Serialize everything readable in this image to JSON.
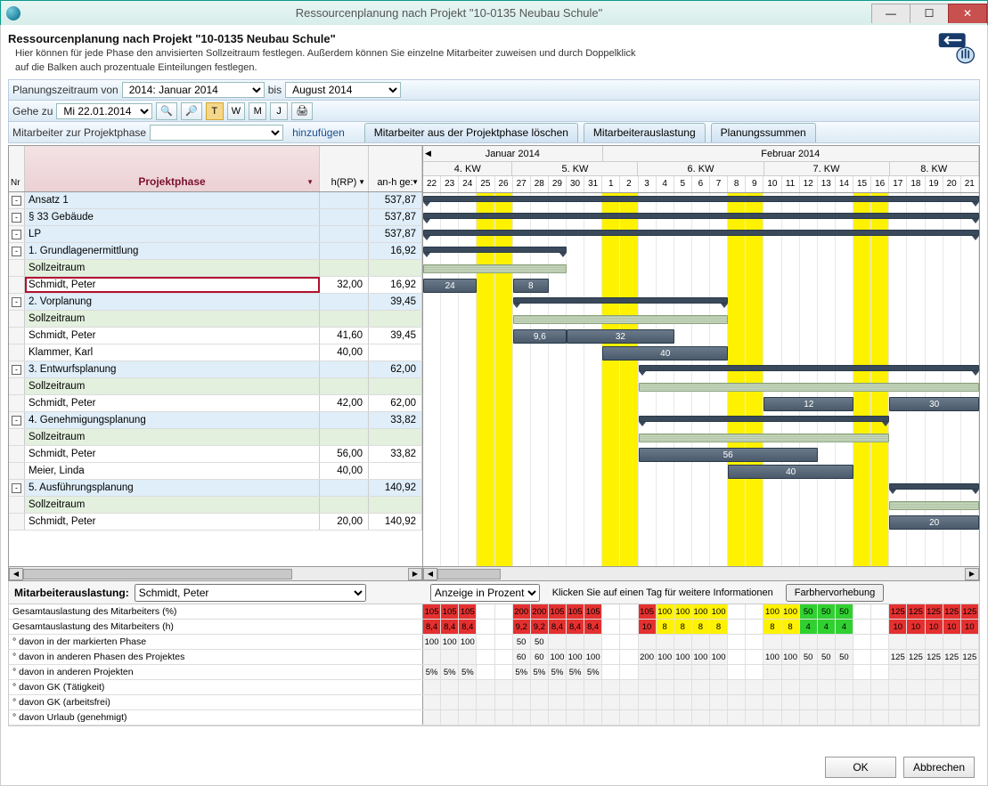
{
  "window": {
    "title": "Ressourcenplanung nach Projekt \"10-0135 Neubau Schule\"",
    "min": "—",
    "max": "☐",
    "close": "✕"
  },
  "header": {
    "title": "Ressourcenplanung nach Projekt \"10-0135 Neubau Schule\"",
    "desc1": "Hier können für jede Phase den anvisierten Sollzeitraum festlegen. Außerdem können Sie einzelne Mitarbeiter zuweisen und durch Doppelklick",
    "desc2": "auf die Balken auch prozentuale Einteilungen festlegen."
  },
  "toolbar1": {
    "label1": "Planungszeitraum von",
    "from": "2014: Januar 2014",
    "to_lbl": "bis",
    "to": "August 2014"
  },
  "toolbar2": {
    "goto_lbl": "Gehe zu",
    "goto_date": "Mi 22.01.2014",
    "btns": [
      "T",
      "W",
      "M",
      "J"
    ]
  },
  "toolbar3": {
    "assign_lbl": "Mitarbeiter zur Projektphase",
    "add": "hinzufügen",
    "tabs": [
      "Mitarbeiter aus der Projektphase löschen",
      "Mitarbeiterauslastung",
      "Planungssummen"
    ]
  },
  "columns": {
    "nr": "Nr",
    "phase": "Projektphase",
    "hrp": "h(RP)",
    "anh": "an-h ge:"
  },
  "months": [
    "Januar 2014",
    "Februar 2014"
  ],
  "weeks": [
    "4. KW",
    "5. KW",
    "6. KW",
    "7. KW",
    "8. KW"
  ],
  "days": [
    "22",
    "23",
    "24",
    "25",
    "26",
    "27",
    "28",
    "29",
    "30",
    "31",
    "1",
    "2",
    "3",
    "4",
    "5",
    "6",
    "7",
    "8",
    "9",
    "10",
    "11",
    "12",
    "13",
    "14",
    "15",
    "16",
    "17",
    "18",
    "19",
    "20",
    "21"
  ],
  "weekend_idx": [
    3,
    4,
    10,
    11,
    17,
    18,
    24,
    25
  ],
  "rows": [
    {
      "exp": "-",
      "label": "Ansatz 1",
      "hrp": "",
      "anh": "537,87",
      "cls": "row-blue",
      "type": "sum",
      "bar": {
        "start": 0,
        "end": 31
      }
    },
    {
      "exp": "-",
      "label": "§ 33 Gebäude",
      "hrp": "",
      "anh": "537,87",
      "cls": "row-blue",
      "type": "sum",
      "bar": {
        "start": 0,
        "end": 31
      }
    },
    {
      "exp": "-",
      "label": "LP",
      "hrp": "",
      "anh": "537,87",
      "cls": "row-blue",
      "type": "sum",
      "bar": {
        "start": 0,
        "end": 31
      }
    },
    {
      "exp": "-",
      "label": "1. Grundlagenermittlung",
      "hrp": "",
      "anh": "16,92",
      "cls": "row-blue",
      "type": "sum",
      "bar": {
        "start": 0,
        "end": 8
      }
    },
    {
      "exp": "",
      "label": "Sollzeitraum",
      "hrp": "",
      "anh": "",
      "cls": "row-green",
      "type": "soll",
      "bar": {
        "start": 0,
        "end": 8
      }
    },
    {
      "exp": "",
      "label": "Schmidt, Peter",
      "hrp": "32,00",
      "anh": "16,92",
      "cls": "row-white row-selected",
      "type": "work",
      "bars": [
        {
          "start": 0,
          "end": 3,
          "txt": "24"
        },
        {
          "start": 5,
          "end": 7,
          "txt": "8"
        }
      ]
    },
    {
      "exp": "-",
      "label": "2. Vorplanung",
      "hrp": "",
      "anh": "39,45",
      "cls": "row-blue",
      "type": "sum",
      "bar": {
        "start": 5,
        "end": 17
      }
    },
    {
      "exp": "",
      "label": "Sollzeitraum",
      "hrp": "",
      "anh": "",
      "cls": "row-green",
      "type": "soll",
      "bar": {
        "start": 5,
        "end": 17
      }
    },
    {
      "exp": "",
      "label": "Schmidt, Peter",
      "hrp": "41,60",
      "anh": "39,45",
      "cls": "row-white",
      "type": "work",
      "bars": [
        {
          "start": 5,
          "end": 8,
          "txt": "9,6"
        },
        {
          "start": 8,
          "end": 14,
          "txt": "32"
        }
      ]
    },
    {
      "exp": "",
      "label": "Klammer, Karl",
      "hrp": "40,00",
      "anh": "",
      "cls": "row-white",
      "type": "work",
      "bars": [
        {
          "start": 10,
          "end": 17,
          "txt": "40"
        }
      ]
    },
    {
      "exp": "-",
      "label": "3. Entwurfsplanung",
      "hrp": "",
      "anh": "62,00",
      "cls": "row-blue",
      "type": "sum",
      "bar": {
        "start": 12,
        "end": 31
      }
    },
    {
      "exp": "",
      "label": "Sollzeitraum",
      "hrp": "",
      "anh": "",
      "cls": "row-green",
      "type": "soll",
      "bar": {
        "start": 12,
        "end": 31
      }
    },
    {
      "exp": "",
      "label": "Schmidt, Peter",
      "hrp": "42,00",
      "anh": "62,00",
      "cls": "row-white",
      "type": "work",
      "bars": [
        {
          "start": 19,
          "end": 24,
          "txt": "12"
        },
        {
          "start": 26,
          "end": 31,
          "txt": "30"
        }
      ]
    },
    {
      "exp": "-",
      "label": "4. Genehmigungsplanung",
      "hrp": "",
      "anh": "33,82",
      "cls": "row-blue",
      "type": "sum",
      "bar": {
        "start": 12,
        "end": 26
      }
    },
    {
      "exp": "",
      "label": "Sollzeitraum",
      "hrp": "",
      "anh": "",
      "cls": "row-green",
      "type": "soll",
      "bar": {
        "start": 12,
        "end": 26
      }
    },
    {
      "exp": "",
      "label": "Schmidt, Peter",
      "hrp": "56,00",
      "anh": "33,82",
      "cls": "row-white",
      "type": "work",
      "bars": [
        {
          "start": 12,
          "end": 22,
          "txt": "56"
        }
      ]
    },
    {
      "exp": "",
      "label": "Meier, Linda",
      "hrp": "40,00",
      "anh": "",
      "cls": "row-white",
      "type": "work",
      "bars": [
        {
          "start": 17,
          "end": 24,
          "txt": "40"
        }
      ]
    },
    {
      "exp": "-",
      "label": "5. Ausführungsplanung",
      "hrp": "",
      "anh": "140,92",
      "cls": "row-blue",
      "type": "sum",
      "bar": {
        "start": 26,
        "end": 31
      }
    },
    {
      "exp": "",
      "label": "Sollzeitraum",
      "hrp": "",
      "anh": "",
      "cls": "row-green",
      "type": "soll",
      "bar": {
        "start": 26,
        "end": 31
      }
    },
    {
      "exp": "",
      "label": "Schmidt, Peter",
      "hrp": "20,00",
      "anh": "140,92",
      "cls": "row-white",
      "type": "work",
      "bars": [
        {
          "start": 26,
          "end": 31,
          "txt": "20"
        }
      ]
    }
  ],
  "util": {
    "label": "Mitarbeiterauslastung:",
    "employee": "Schmidt, Peter",
    "mode": "Anzeige in Prozent",
    "hint": "Klicken Sie auf einen Tag für weitere Informationen",
    "color_btn": "Farbhervorhebung",
    "rows": [
      {
        "label": "Gesamtauslastung des Mitarbeiters (%)",
        "cells": [
          {
            "v": "105",
            "c": "red"
          },
          {
            "v": "105",
            "c": "red"
          },
          {
            "v": "105",
            "c": "red"
          },
          {
            "v": "",
            "c": "blank"
          },
          {
            "v": "",
            "c": "blank"
          },
          {
            "v": "200",
            "c": "red"
          },
          {
            "v": "200",
            "c": "red"
          },
          {
            "v": "105",
            "c": "red"
          },
          {
            "v": "105",
            "c": "red"
          },
          {
            "v": "105",
            "c": "red"
          },
          {
            "v": "",
            "c": "blank"
          },
          {
            "v": "",
            "c": "blank"
          },
          {
            "v": "105",
            "c": "red"
          },
          {
            "v": "100",
            "c": "yellow"
          },
          {
            "v": "100",
            "c": "yellow"
          },
          {
            "v": "100",
            "c": "yellow"
          },
          {
            "v": "100",
            "c": "yellow"
          },
          {
            "v": "",
            "c": "blank"
          },
          {
            "v": "",
            "c": "blank"
          },
          {
            "v": "100",
            "c": "yellow"
          },
          {
            "v": "100",
            "c": "yellow"
          },
          {
            "v": "50",
            "c": "green"
          },
          {
            "v": "50",
            "c": "green"
          },
          {
            "v": "50",
            "c": "green"
          },
          {
            "v": "",
            "c": "blank"
          },
          {
            "v": "",
            "c": "blank"
          },
          {
            "v": "125",
            "c": "red"
          },
          {
            "v": "125",
            "c": "red"
          },
          {
            "v": "125",
            "c": "red"
          },
          {
            "v": "125",
            "c": "red"
          },
          {
            "v": "125",
            "c": "red"
          }
        ]
      },
      {
        "label": "Gesamtauslastung des Mitarbeiters (h)",
        "cells": [
          {
            "v": "8,4",
            "c": "red"
          },
          {
            "v": "8,4",
            "c": "red"
          },
          {
            "v": "8,4",
            "c": "red"
          },
          {
            "v": "",
            "c": "blank"
          },
          {
            "v": "",
            "c": "blank"
          },
          {
            "v": "9,2",
            "c": "red"
          },
          {
            "v": "9,2",
            "c": "red"
          },
          {
            "v": "8,4",
            "c": "red"
          },
          {
            "v": "8,4",
            "c": "red"
          },
          {
            "v": "8,4",
            "c": "red"
          },
          {
            "v": "",
            "c": "blank"
          },
          {
            "v": "",
            "c": "blank"
          },
          {
            "v": "10",
            "c": "red"
          },
          {
            "v": "8",
            "c": "yellow"
          },
          {
            "v": "8",
            "c": "yellow"
          },
          {
            "v": "8",
            "c": "yellow"
          },
          {
            "v": "8",
            "c": "yellow"
          },
          {
            "v": "",
            "c": "blank"
          },
          {
            "v": "",
            "c": "blank"
          },
          {
            "v": "8",
            "c": "yellow"
          },
          {
            "v": "8",
            "c": "yellow"
          },
          {
            "v": "4",
            "c": "green"
          },
          {
            "v": "4",
            "c": "green"
          },
          {
            "v": "4",
            "c": "green"
          },
          {
            "v": "",
            "c": "blank"
          },
          {
            "v": "",
            "c": "blank"
          },
          {
            "v": "10",
            "c": "red"
          },
          {
            "v": "10",
            "c": "red"
          },
          {
            "v": "10",
            "c": "red"
          },
          {
            "v": "10",
            "c": "red"
          },
          {
            "v": "10",
            "c": "red"
          }
        ]
      },
      {
        "label": "° davon in der markierten Phase",
        "cells": [
          {
            "v": "100",
            "c": "grey"
          },
          {
            "v": "100",
            "c": "grey"
          },
          {
            "v": "100",
            "c": "grey"
          },
          {
            "v": "",
            "c": "blank"
          },
          {
            "v": "",
            "c": "blank"
          },
          {
            "v": "50",
            "c": "grey"
          },
          {
            "v": "50",
            "c": "grey"
          },
          {
            "v": "",
            "c": "grey"
          },
          {
            "v": "",
            "c": "grey"
          },
          {
            "v": "",
            "c": "grey"
          },
          {
            "v": "",
            "c": "blank"
          },
          {
            "v": "",
            "c": "blank"
          },
          {
            "v": "",
            "c": "grey"
          },
          {
            "v": "",
            "c": "grey"
          },
          {
            "v": "",
            "c": "grey"
          },
          {
            "v": "",
            "c": "grey"
          },
          {
            "v": "",
            "c": "grey"
          },
          {
            "v": "",
            "c": "blank"
          },
          {
            "v": "",
            "c": "blank"
          },
          {
            "v": "",
            "c": "grey"
          },
          {
            "v": "",
            "c": "grey"
          },
          {
            "v": "",
            "c": "grey"
          },
          {
            "v": "",
            "c": "grey"
          },
          {
            "v": "",
            "c": "grey"
          },
          {
            "v": "",
            "c": "blank"
          },
          {
            "v": "",
            "c": "blank"
          },
          {
            "v": "",
            "c": "grey"
          },
          {
            "v": "",
            "c": "grey"
          },
          {
            "v": "",
            "c": "grey"
          },
          {
            "v": "",
            "c": "grey"
          },
          {
            "v": "",
            "c": "grey"
          }
        ]
      },
      {
        "label": "° davon in anderen Phasen des Projektes",
        "cells": [
          {
            "v": "",
            "c": "grey"
          },
          {
            "v": "",
            "c": "grey"
          },
          {
            "v": "",
            "c": "grey"
          },
          {
            "v": "",
            "c": "blank"
          },
          {
            "v": "",
            "c": "blank"
          },
          {
            "v": "60",
            "c": "grey"
          },
          {
            "v": "60",
            "c": "grey"
          },
          {
            "v": "100",
            "c": "grey"
          },
          {
            "v": "100",
            "c": "grey"
          },
          {
            "v": "100",
            "c": "grey"
          },
          {
            "v": "",
            "c": "blank"
          },
          {
            "v": "",
            "c": "blank"
          },
          {
            "v": "200",
            "c": "grey"
          },
          {
            "v": "100",
            "c": "grey"
          },
          {
            "v": "100",
            "c": "grey"
          },
          {
            "v": "100",
            "c": "grey"
          },
          {
            "v": "100",
            "c": "grey"
          },
          {
            "v": "",
            "c": "blank"
          },
          {
            "v": "",
            "c": "blank"
          },
          {
            "v": "100",
            "c": "grey"
          },
          {
            "v": "100",
            "c": "grey"
          },
          {
            "v": "50",
            "c": "grey"
          },
          {
            "v": "50",
            "c": "grey"
          },
          {
            "v": "50",
            "c": "grey"
          },
          {
            "v": "",
            "c": "blank"
          },
          {
            "v": "",
            "c": "blank"
          },
          {
            "v": "125",
            "c": "grey"
          },
          {
            "v": "125",
            "c": "grey"
          },
          {
            "v": "125",
            "c": "grey"
          },
          {
            "v": "125",
            "c": "grey"
          },
          {
            "v": "125",
            "c": "grey"
          }
        ]
      },
      {
        "label": "° davon in anderen Projekten",
        "cells": [
          {
            "v": "5%",
            "c": "grey"
          },
          {
            "v": "5%",
            "c": "grey"
          },
          {
            "v": "5%",
            "c": "grey"
          },
          {
            "v": "",
            "c": "blank"
          },
          {
            "v": "",
            "c": "blank"
          },
          {
            "v": "5%",
            "c": "grey"
          },
          {
            "v": "5%",
            "c": "grey"
          },
          {
            "v": "5%",
            "c": "grey"
          },
          {
            "v": "5%",
            "c": "grey"
          },
          {
            "v": "5%",
            "c": "grey"
          },
          {
            "v": "",
            "c": "blank"
          },
          {
            "v": "",
            "c": "blank"
          },
          {
            "v": "",
            "c": "grey"
          },
          {
            "v": "",
            "c": "grey"
          },
          {
            "v": "",
            "c": "grey"
          },
          {
            "v": "",
            "c": "grey"
          },
          {
            "v": "",
            "c": "grey"
          },
          {
            "v": "",
            "c": "blank"
          },
          {
            "v": "",
            "c": "blank"
          },
          {
            "v": "",
            "c": "grey"
          },
          {
            "v": "",
            "c": "grey"
          },
          {
            "v": "",
            "c": "grey"
          },
          {
            "v": "",
            "c": "grey"
          },
          {
            "v": "",
            "c": "grey"
          },
          {
            "v": "",
            "c": "blank"
          },
          {
            "v": "",
            "c": "blank"
          },
          {
            "v": "",
            "c": "grey"
          },
          {
            "v": "",
            "c": "grey"
          },
          {
            "v": "",
            "c": "grey"
          },
          {
            "v": "",
            "c": "grey"
          },
          {
            "v": "",
            "c": "grey"
          }
        ]
      },
      {
        "label": "° davon GK (Tätigkeit)",
        "cells": []
      },
      {
        "label": "° davon GK (arbeitsfrei)",
        "cells": []
      },
      {
        "label": "° davon Urlaub (genehmigt)",
        "cells": []
      }
    ]
  },
  "footer": {
    "ok": "OK",
    "cancel": "Abbrechen"
  }
}
